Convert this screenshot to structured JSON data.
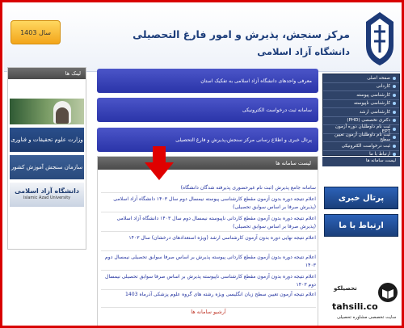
{
  "header": {
    "year_label": "سال 1403",
    "title_line1": "مرکز سنجش، پذیرش و امور فارغ التحصیلی",
    "title_line2": "دانشگاه آزاد اسلامی"
  },
  "left_sidebar": {
    "heading": "لینک ها",
    "banner1": "وزارت علوم تحقیقات و فناوری",
    "banner2": "سازمان سنجش آموزش کشور",
    "banner3_title": "دانشگاه آزاد اسلامی",
    "banner3_sub": "Islamic Azad University"
  },
  "center": {
    "btn1": "معرفی واحدهای دانشگاه آزاد اسلامی به تفکیک استان",
    "btn2": "سامانه ثبت درخواست الکترونیکی",
    "btn3": "پرتال خبری و اطلاع رسانی مرکز سنجش،پذیرش و فارغ التحصیلی",
    "news_heading": "لیست سامانه ها",
    "news_items": [
      "سامانه جامع پذیرش (ثبت نام غیرحضوری پذیرفته شدگان دانشگاه)",
      "اعلام نتیجه دوره بدون آزمون مقطع کارشناسی پیوسته نیمسال دوم سال ۱۴۰۳ دانشگاه آزاد اسلامی (پذیرش صرفا بر اساس سوابق تحصیلی)",
      "اعلام نتیجه دوره بدون آزمون مقطع کاردانی ناپیوسته نیمسال دوم سال ۱۴۰۳ دانشگاه آزاد اسلامی (پذیرش صرفا بر اساس سوابق تحصیلی)",
      "اعلام نتیجه نهایی دوره بدون آزمون کارشناسی ارشد (ویژه استعدادهای درخشان) سال ۱۴۰۳",
      "اعلام نتیجه دوره بدون آزمون مقطع کاردانی پیوسته پذیرش بر اساس صرفا سوابق تحصیلی نیمسال دوم ۱۴۰۳",
      "اعلام نتیجه دوره بدون آزمون مقطع کارشناسی ناپیوسته پذیرش بر اساس صرفا سوابق تحصیلی نیمسال دوم ۱۴۰۳",
      "اعلام نتیجه آزمون تعیین سطح زبان انگلیسی ویژه رشته های گروه علوم پزشکی آذرماه 1403"
    ],
    "archive": "آرشیو سامانه ها"
  },
  "right_menu": {
    "items": [
      "صفحه اصلی",
      "کاردانی",
      "کارشناسی پیوسته",
      "کارشناسی ناپیوسته",
      "کارشناسی ارشد",
      "دکتری تخصصی (PHD)",
      "ثبت نام داوطلبان دوره آزمون EPT",
      "ثبت نام داوطلبان آزمون تعیین سطح",
      "ثبت درخواست الکترونیکی",
      "ارتباط با ما"
    ],
    "sub_heading": "لیست سامانه ها",
    "portal_btn": "پرتال خبری",
    "contact_btn": "ارتباط با ما"
  },
  "watermark": {
    "brand": "تحصیلکو",
    "url": "tahsili.co",
    "tagline": "سایت تخصصی مشاوره تحصیلی"
  },
  "colors": {
    "frame": "#d90000",
    "center_button": "#3a44b8",
    "menu_bg": "#2f4368",
    "link": "#1f2f9e"
  }
}
